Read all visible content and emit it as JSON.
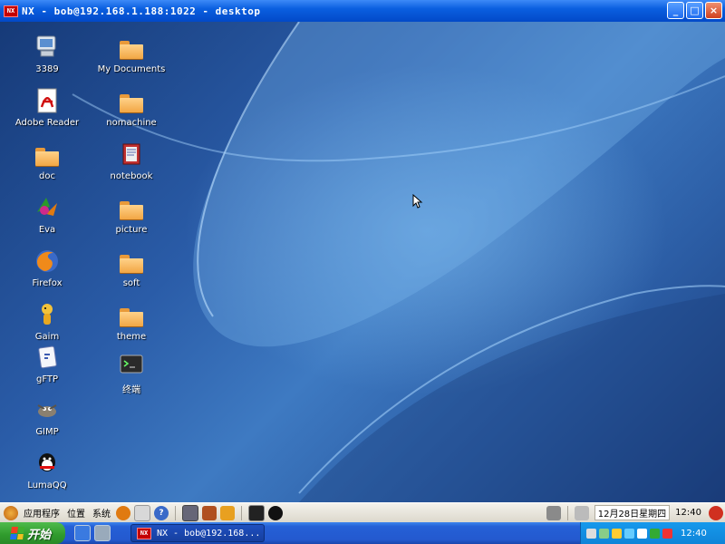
{
  "window": {
    "title": "NX - bob@192.168.1.188:1022 - desktop",
    "logo_text": "NX",
    "buttons": [
      "_",
      "□",
      "×"
    ]
  },
  "desktop": {
    "icons": [
      {
        "label": "3389",
        "icon": "computer-icon"
      },
      {
        "label": "Adobe Reader",
        "icon": "adobe-reader-icon"
      },
      {
        "label": "doc",
        "icon": "folder-icon"
      },
      {
        "label": "Eva",
        "icon": "eva-icon"
      },
      {
        "label": "Firefox",
        "icon": "firefox-icon"
      },
      {
        "label": "Gaim",
        "icon": "gaim-icon"
      },
      {
        "label": "gFTP",
        "icon": "gftp-icon"
      },
      {
        "label": "GIMP",
        "icon": "gimp-icon"
      },
      {
        "label": "LumaQQ",
        "icon": "lumaqq-icon"
      },
      {
        "label": "My Documents",
        "icon": "folder-icon"
      },
      {
        "label": "nomachine",
        "icon": "folder-icon"
      },
      {
        "label": "notebook",
        "icon": "notebook-icon"
      },
      {
        "label": "picture",
        "icon": "folder-icon"
      },
      {
        "label": "soft",
        "icon": "folder-icon"
      },
      {
        "label": "theme",
        "icon": "folder-icon"
      },
      {
        "label": "终端",
        "icon": "terminal-icon"
      }
    ]
  },
  "gnome_panel": {
    "menus": [
      "应用程序",
      "位置",
      "系统"
    ],
    "launchers": [
      "firefox-icon",
      "mail-icon",
      "help-icon",
      "screenshot-icon",
      "photo-icon",
      "lock-icon",
      "terminal-icon",
      "lumaqq-icon"
    ],
    "clock": "12月28日星期四",
    "time": "12:40"
  },
  "xp_taskbar": {
    "start_label": "开始",
    "task_label": "NX - bob@192.168...",
    "time": "12:40"
  },
  "colors": {
    "titlebar": "#0a5fe0",
    "start_green": "#2f9a2c",
    "tray_blue": "#0f84d8"
  }
}
